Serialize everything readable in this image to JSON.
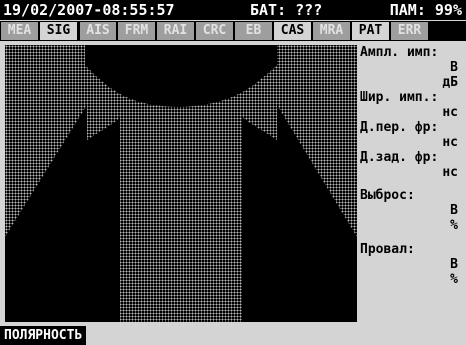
{
  "status_bar": {
    "datetime": "19/02/2007-08:55:57",
    "battery": "БАТ: ???",
    "memory": "ПАМ: 99%"
  },
  "tabs": [
    {
      "label": "MEA",
      "active": false
    },
    {
      "label": "SIG",
      "active": true
    },
    {
      "label": "AIS",
      "active": false
    },
    {
      "label": "FRM",
      "active": false
    },
    {
      "label": "RAI",
      "active": false
    },
    {
      "label": "CRC",
      "active": false
    },
    {
      "label": "EB",
      "active": false
    },
    {
      "label": "CAS",
      "active": true
    },
    {
      "label": "MRA",
      "active": false
    },
    {
      "label": "PAT",
      "active": true
    },
    {
      "label": "ERR",
      "active": false
    }
  ],
  "measurements": {
    "amplitude_label": "Ампл. имп:",
    "amplitude_unit_1": "В",
    "amplitude_unit_2": "дБ",
    "width_label": "Шир. имп.:",
    "width_unit": "нс",
    "rise_label": "Д.пер. фр:",
    "rise_unit": "нс",
    "fall_label": "Д.зад. фр:",
    "fall_unit": "нс",
    "overshoot_label": "Выброс:",
    "overshoot_unit_1": "В",
    "overshoot_unit_2": "%",
    "undershoot_label": "Провал:",
    "undershoot_unit_1": "В",
    "undershoot_unit_2": "%"
  },
  "bottom_button": {
    "label": "ПОЛЯРНОСТЬ"
  },
  "colors": {
    "background": "#d4d4d4",
    "bar": "#000000",
    "tab_inactive": "#9e9e9e",
    "scope_dots": "#b9b9b9"
  }
}
